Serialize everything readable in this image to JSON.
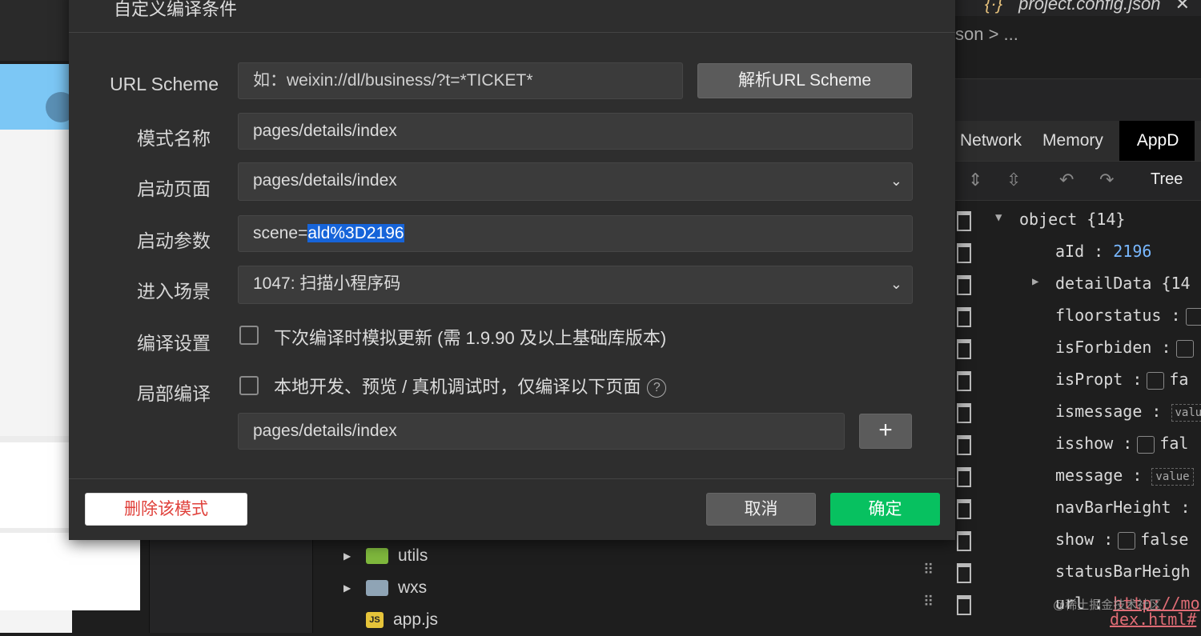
{
  "background": {
    "editor_tab": "project.config.json",
    "breadcrumb": "son > ...",
    "devtools_tabs": [
      "Network",
      "Memory",
      "AppD"
    ],
    "toolbar_view": "Tree",
    "files": [
      {
        "name": "utils",
        "type": "folder-green"
      },
      {
        "name": "wxs",
        "type": "folder-grey"
      },
      {
        "name": "app.js",
        "type": "js"
      }
    ],
    "tree": {
      "root": "object",
      "root_count": "{14}",
      "rows": [
        {
          "key": "aId",
          "value": "2196"
        },
        {
          "key": "detailData",
          "value": "{14"
        },
        {
          "key": "floorstatus",
          "value": ""
        },
        {
          "key": "isForbiden",
          "value": ""
        },
        {
          "key": "isPropt",
          "value": "fa"
        },
        {
          "key": "ismessage",
          "value": "valu"
        },
        {
          "key": "isshow",
          "value": "fal"
        },
        {
          "key": "message",
          "value": "value"
        },
        {
          "key": "navBarHeight",
          "value": ""
        },
        {
          "key": "show",
          "value": "false"
        },
        {
          "key": "statusBarHeigh",
          "value": ""
        },
        {
          "key": "url",
          "value": "http://mo",
          "value2": "dex.html#"
        }
      ]
    },
    "watermark": "@稀土掘金技术社区"
  },
  "dialog": {
    "title": "自定义编译条件",
    "url_scheme": {
      "label": "URL Scheme",
      "placeholder": "如：weixin://dl/business/?t=*TICKET*",
      "parse_button": "解析URL Scheme"
    },
    "mode_name": {
      "label": "模式名称",
      "value": "pages/details/index"
    },
    "start_page": {
      "label": "启动页面",
      "value": "pages/details/index"
    },
    "start_params": {
      "label": "启动参数",
      "prefix": "scene=",
      "selected": "ald%3D2196"
    },
    "scene": {
      "label": "进入场景",
      "value": "1047: 扫描小程序码"
    },
    "compile_settings": {
      "label": "编译设置",
      "checkbox_text": "下次编译时模拟更新 (需 1.9.90 及以上基础库版本)"
    },
    "partial_compile": {
      "label": "局部编译",
      "checkbox_text": "本地开发、预览 / 真机调试时，仅编译以下页面",
      "help": "?",
      "page_value": "pages/details/index",
      "add_button": "+"
    },
    "footer": {
      "delete_button": "删除该模式",
      "cancel_button": "取消",
      "confirm_button": "确定"
    }
  }
}
